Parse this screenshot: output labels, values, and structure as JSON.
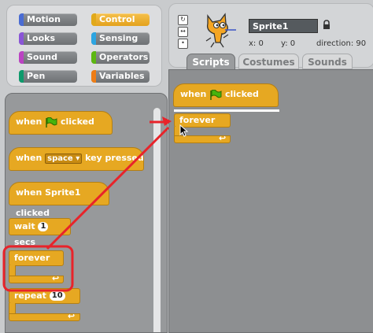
{
  "categories": [
    {
      "label": "Motion",
      "color": "#4a6cd4"
    },
    {
      "label": "Control",
      "color": "#e1a91a"
    },
    {
      "label": "Looks",
      "color": "#8a55d7"
    },
    {
      "label": "Sensing",
      "color": "#2ca5e2"
    },
    {
      "label": "Sound",
      "color": "#bb42c3"
    },
    {
      "label": "Operators",
      "color": "#5cb712"
    },
    {
      "label": "Pen",
      "color": "#0e9a6c"
    },
    {
      "label": "Variables",
      "color": "#ee7d16"
    }
  ],
  "selected_category": "Control",
  "palette": {
    "when_clicked": {
      "when": "when",
      "clicked": "clicked"
    },
    "when_key": {
      "when": "when",
      "key": "space",
      "suffix": "key pressed"
    },
    "when_sprite": {
      "label": "when Sprite1 clicked"
    },
    "wait": {
      "label": "wait",
      "value": "1",
      "unit": "secs"
    },
    "forever": {
      "label": "forever"
    },
    "repeat": {
      "label": "repeat",
      "value": "10"
    },
    "loop_arrow": "↩"
  },
  "sprite": {
    "name": "Sprite1",
    "x_label": "x:",
    "x": "0",
    "y_label": "y:",
    "y": "0",
    "direction_label": "direction:",
    "direction": "90"
  },
  "tabs": [
    {
      "label": "Scripts",
      "active": true
    },
    {
      "label": "Costumes"
    },
    {
      "label": "Sounds"
    }
  ],
  "script": {
    "hat": {
      "when": "when",
      "clicked": "clicked"
    },
    "forever": {
      "label": "forever"
    }
  },
  "accent_block_color": "#e6a822",
  "annotation_color": "#e8232a"
}
